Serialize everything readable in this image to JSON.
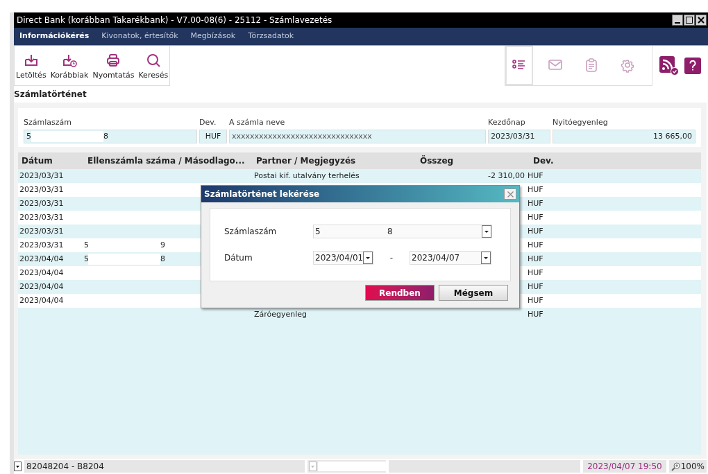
{
  "window": {
    "title": "Direct Bank (korábban Takarékbank) - V7.00-08(6) - 25112 - Számlavezetés"
  },
  "menu": [
    {
      "label": "Információkérés",
      "selected": true
    },
    {
      "label": "Kivonatok, értesítők",
      "selected": false
    },
    {
      "label": "Megbízások",
      "selected": false
    },
    {
      "label": "Törzsadatok",
      "selected": false
    }
  ],
  "toolbar": [
    {
      "label": "Letöltés",
      "kind": "download"
    },
    {
      "label": "Korábbiak",
      "kind": "history"
    },
    {
      "label": "Nyomtatás",
      "kind": "print"
    },
    {
      "label": "Keresés",
      "kind": "search"
    }
  ],
  "view_tabs": [
    {
      "kind": "list",
      "selected": true
    },
    {
      "kind": "mail",
      "selected": false
    },
    {
      "kind": "clipboard",
      "selected": false
    },
    {
      "kind": "settings",
      "selected": false
    }
  ],
  "section_title": "Számlatörténet",
  "account": {
    "number_label": "Számlaszám",
    "number_start": "5",
    "number_end": "8",
    "currency_label": "Dev.",
    "currency": "HUF",
    "name_label": "A számla neve",
    "name": "xxxxxxxxxxxxxxxxxxxxxxxxxxxxxxx",
    "start_label": "Kezdőnap",
    "start": "2023/03/31",
    "balance_label": "Nyitóegyenleg",
    "balance": "13 665,00"
  },
  "table": {
    "columns": [
      "Dátum",
      "Ellenszámla száma / Másodlago...",
      "Partner / Megjegyzés",
      "Összeg",
      "Dev."
    ],
    "rows": [
      {
        "date": "2023/03/31",
        "partner": "Postai kif. utalvány terhelés",
        "amount": "-2 310,00",
        "currency": "HUF"
      },
      {
        "date": "2023/03/31",
        "currency": "HUF"
      },
      {
        "date": "2023/03/31",
        "currency": "HUF"
      },
      {
        "date": "2023/03/31",
        "currency": "HUF"
      },
      {
        "date": "2023/03/31",
        "currency": "HUF"
      },
      {
        "date": "2023/03/31",
        "counter_start": "5",
        "counter_end": "9",
        "currency": "HUF"
      },
      {
        "date": "2023/04/04",
        "counter_start": "5",
        "counter_end": "8",
        "currency": "HUF"
      },
      {
        "date": "2023/04/04",
        "currency": "HUF"
      },
      {
        "date": "2023/04/04",
        "currency": "HUF"
      },
      {
        "date": "2023/04/04",
        "currency": "HUF"
      },
      {
        "partner": "Záróegyenleg",
        "currency": "HUF"
      }
    ]
  },
  "dialog": {
    "title": "Számlatörténet lekérése",
    "account_label": "Számlaszám",
    "account_start": "5",
    "account_end": "8",
    "date_label": "Dátum",
    "date_from": "2023/04/01",
    "separator": "-",
    "date_to": "2023/04/07",
    "ok": "Rendben",
    "cancel": "Mégsem"
  },
  "status_bar": {
    "user": "82048204 - B8204",
    "datetime": "2023/04/07 19:50",
    "zoom": "100%"
  }
}
